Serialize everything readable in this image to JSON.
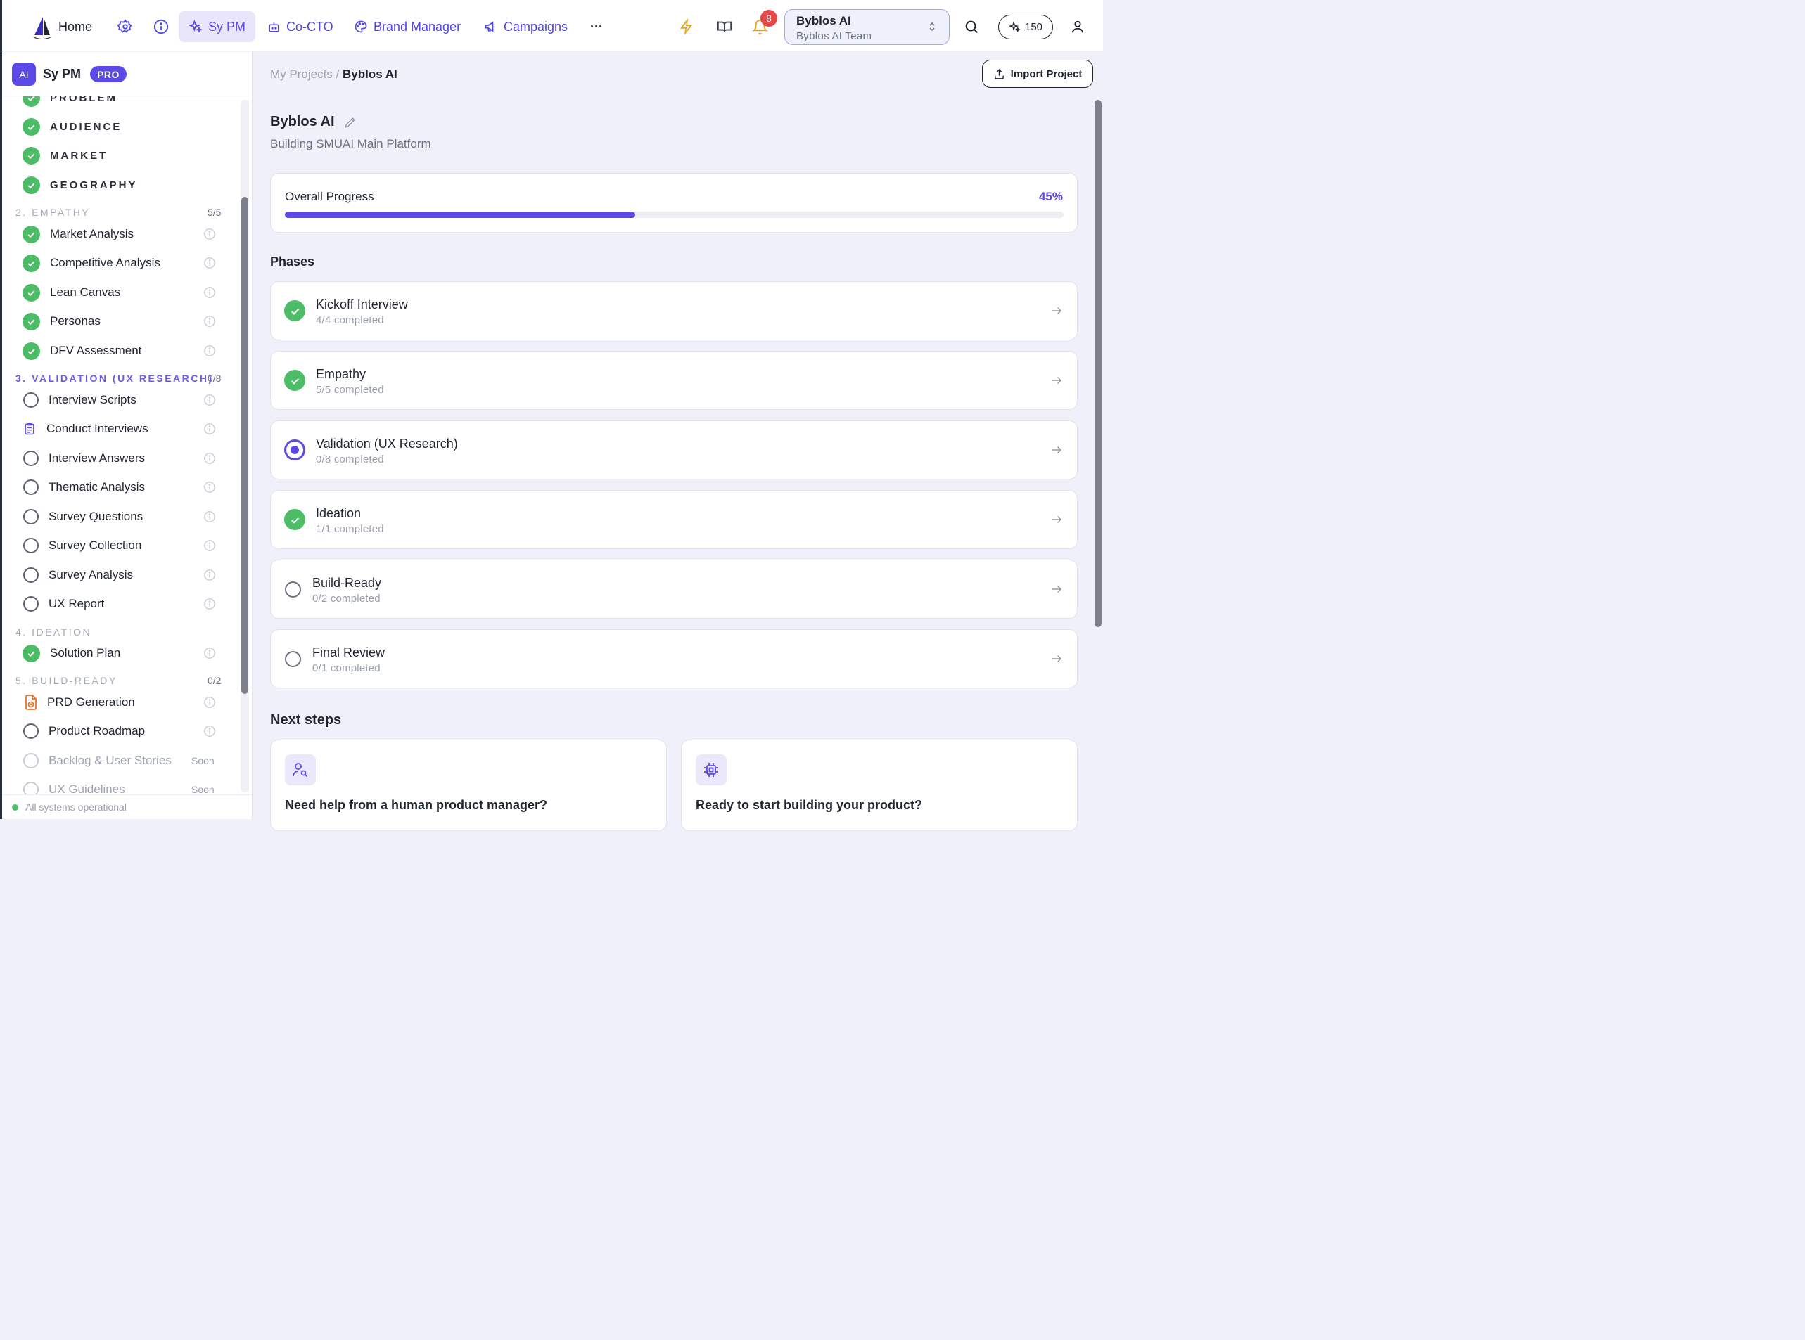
{
  "nav": {
    "home": "Home",
    "items": [
      {
        "label": "Sy PM"
      },
      {
        "label": "Co-CTO"
      },
      {
        "label": "Brand Manager"
      },
      {
        "label": "Campaigns"
      }
    ],
    "more": "···",
    "notifications_count": "8",
    "team": {
      "name": "Byblos AI",
      "subtitle": "Byblos AI Team"
    },
    "credits": "150"
  },
  "sidebar": {
    "ai_badge": "AI",
    "title": "Sy PM",
    "pro": "PRO",
    "kickoff_items": [
      "PROBLEM",
      "AUDIENCE",
      "MARKET",
      "GEOGRAPHY"
    ],
    "sections": [
      {
        "title": "2. EMPATHY",
        "count": "5/5",
        "items": [
          "Market Analysis",
          "Competitive Analysis",
          "Lean Canvas",
          "Personas",
          "DFV Assessment"
        ]
      },
      {
        "title": "3. VALIDATION (UX RESEARCH)",
        "count": "0/8",
        "items": [
          "Interview Scripts",
          "Conduct Interviews",
          "Interview Answers",
          "Thematic Analysis",
          "Survey Questions",
          "Survey Collection",
          "Survey Analysis",
          "UX Report"
        ]
      },
      {
        "title": "4. IDEATION",
        "count": "",
        "items": [
          "Solution Plan"
        ]
      },
      {
        "title": "5. BUILD-READY",
        "count": "0/2",
        "items": [
          "PRD Generation",
          "Product Roadmap",
          "Backlog & User Stories",
          "UX Guidelines"
        ]
      }
    ],
    "soon": "Soon",
    "status": "All systems operational"
  },
  "main": {
    "breadcrumb_root": "My Projects",
    "breadcrumb_sep": " / ",
    "breadcrumb_current": "Byblos AI",
    "import_label": "Import Project",
    "project_title": "Byblos AI",
    "project_subtitle": "Building SMUAI Main Platform",
    "progress": {
      "label": "Overall Progress",
      "percent_label": "45%",
      "value": 0.45
    },
    "phases_heading": "Phases",
    "phases": [
      {
        "name": "Kickoff Interview",
        "progress": "4/4 completed",
        "state": "done"
      },
      {
        "name": "Empathy",
        "progress": "5/5 completed",
        "state": "done"
      },
      {
        "name": "Validation (UX Research)",
        "progress": "0/8 completed",
        "state": "active"
      },
      {
        "name": "Ideation",
        "progress": "1/1 completed",
        "state": "done"
      },
      {
        "name": "Build-Ready",
        "progress": "0/2 completed",
        "state": "todo"
      },
      {
        "name": "Final Review",
        "progress": "0/1 completed",
        "state": "todo"
      }
    ],
    "next_heading": "Next steps",
    "next_steps": [
      {
        "title": "Need help from a human product manager?"
      },
      {
        "title": "Ready to start building your product?"
      }
    ]
  },
  "colors": {
    "accent": "#5b4ae8",
    "success": "#4cbd66",
    "danger": "#e54848"
  }
}
